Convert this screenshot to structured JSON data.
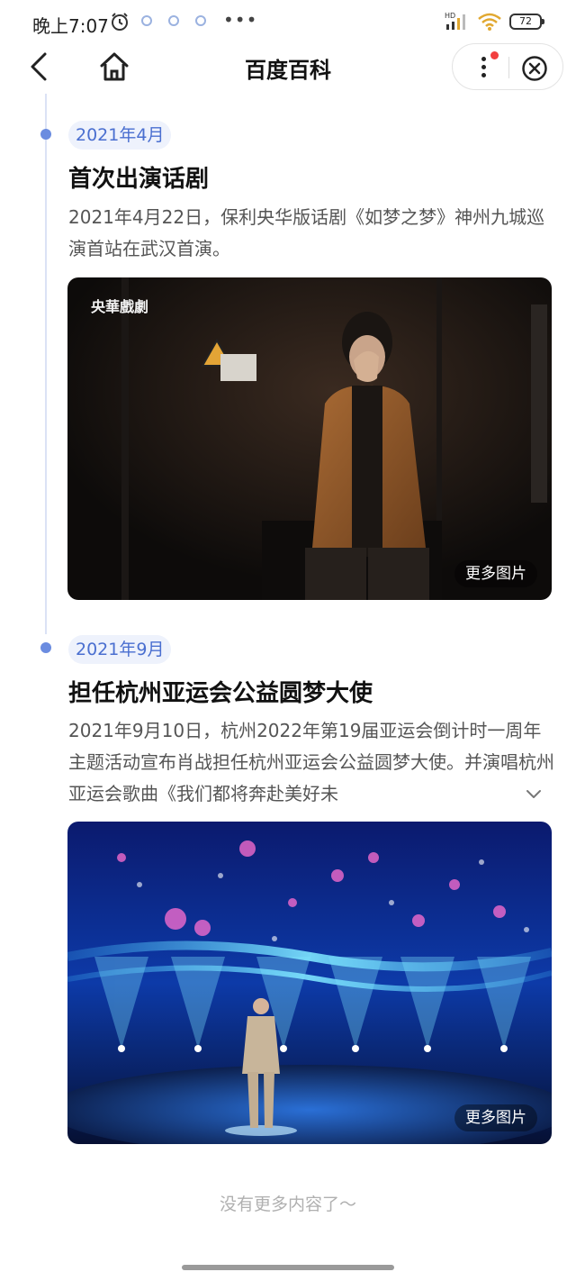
{
  "status_bar": {
    "time": "晚上7:07",
    "more": "•••",
    "battery": "72",
    "signal_label": "HD"
  },
  "nav": {
    "title": "百度百科"
  },
  "entries": [
    {
      "date": "2021年4月",
      "title": "首次出演话剧",
      "desc": "2021年4月22日，保利央华版话剧《如梦之梦》神州九城巡演首站在武汉首演。",
      "watermark": "央華戲劇",
      "more_photos": "更多图片"
    },
    {
      "date": "2021年9月",
      "title": "担任杭州亚运会公益圆梦大使",
      "desc": "2021年9月10日，杭州2022年第19届亚运会倒计时一周年主题活动宣布肖战担任杭州亚运会公益圆梦大使。并演唱杭州亚运会歌曲《我们都将奔赴美好未",
      "more_photos": "更多图片"
    }
  ],
  "footer": {
    "no_more": "没有更多内容了～"
  },
  "colors": {
    "accent": "#4a6fd0",
    "timeline_dot": "#6b8ce0",
    "badge": "#f23f3f"
  }
}
